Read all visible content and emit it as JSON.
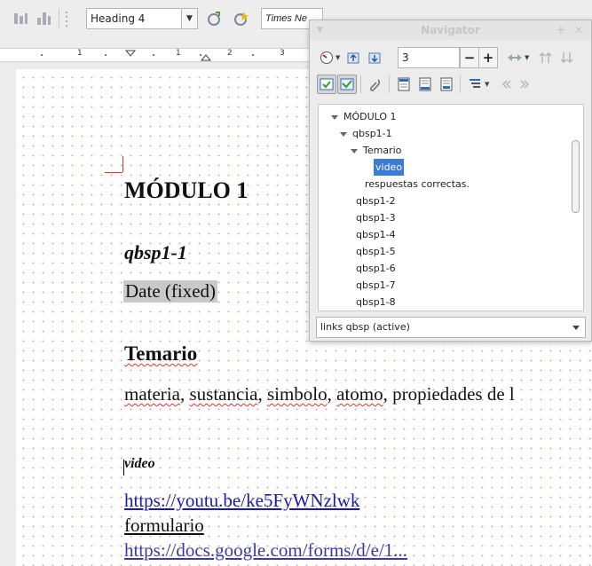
{
  "toolbar": {
    "paragraph_style": "Heading 4",
    "font_name": "Times Ne"
  },
  "ruler": {
    "numbers": [
      "1",
      "1",
      "1",
      "2",
      "3"
    ]
  },
  "document": {
    "heading1": "MÓDULO 1",
    "heading2": "qbsp1-1",
    "date_field": "Date (fixed)",
    "heading3": "Temario",
    "materia_words": [
      "materia",
      "sustancia",
      "simbolo",
      "atomo"
    ],
    "materia_rest": "propiedades de l",
    "heading4": "video",
    "link": "https://youtu.be/ke5FyWNzlwk",
    "formulario": "formulario",
    "cutoff_line": "https://docs.google.com/forms/d/e/1..."
  },
  "navigator": {
    "title": "Navigator",
    "heading_level": "3",
    "tree": [
      {
        "label": "MÓDULO 1",
        "level": 0,
        "expanded": true
      },
      {
        "label": "qbsp1-1",
        "level": 1,
        "expanded": true
      },
      {
        "label": "Temario",
        "level": 2,
        "expanded": true
      },
      {
        "label": "video",
        "level": 3,
        "selected": true
      },
      {
        "label": "respuestas correctas.",
        "level": 2
      },
      {
        "label": "qbsp1-2",
        "level": 1
      },
      {
        "label": "qbsp1-3",
        "level": 1
      },
      {
        "label": "qbsp1-4",
        "level": 1
      },
      {
        "label": "qbsp1-5",
        "level": 1
      },
      {
        "label": "qbsp1-6",
        "level": 1
      },
      {
        "label": "qbsp1-7",
        "level": 1
      },
      {
        "label": "qbsp1-8",
        "level": 1
      }
    ],
    "document_select": "links qbsp (active)"
  },
  "colors": {
    "accent_selection": "#3d7bd9",
    "link": "#1a1aa6",
    "spell_error": "#dd3333"
  }
}
